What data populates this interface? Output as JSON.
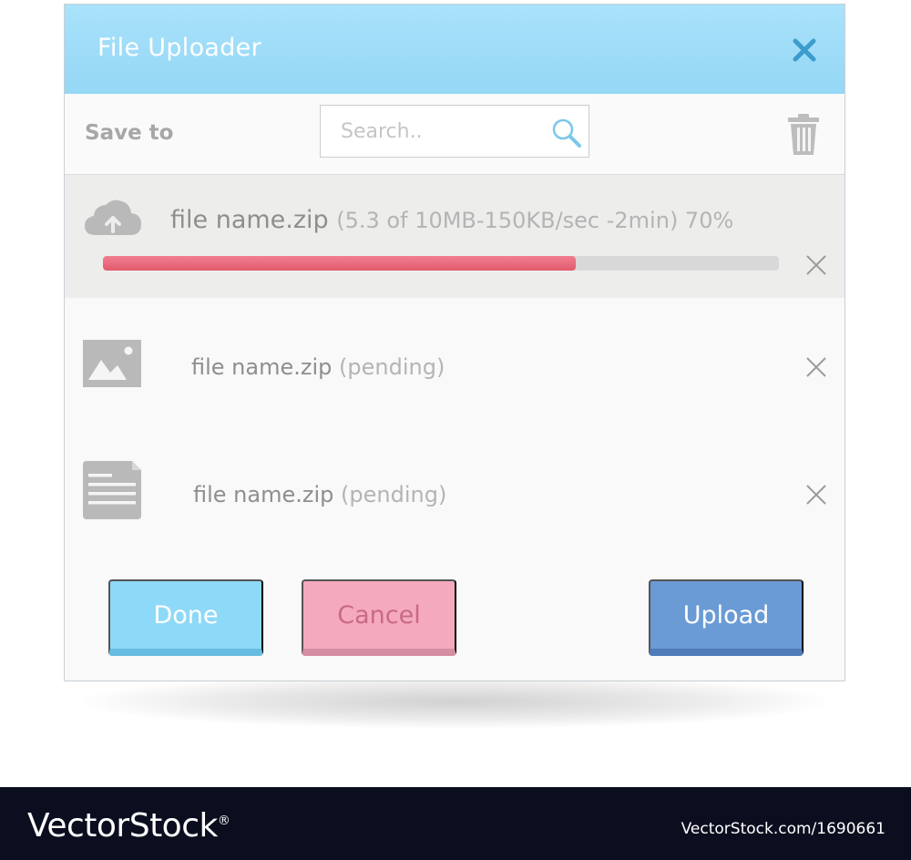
{
  "dialog": {
    "title": "File Uploader",
    "close_icon": "close-icon",
    "accent_color": "#95d7f5"
  },
  "toolbar": {
    "save_to_label": "Save to",
    "search_placeholder": "Search..",
    "search_icon": "search-icon",
    "trash_icon": "trash-icon"
  },
  "files": [
    {
      "icon": "cloud-upload-icon",
      "name": "file name.zip",
      "status": "(5.3 of 10MB-150KB/sec -2min) 70%",
      "progress_percent": 70,
      "progress_color": "#e25a6d",
      "remove_icon": "remove-icon"
    },
    {
      "icon": "image-file-icon",
      "name": "file name.zip",
      "status": "(pending)",
      "remove_icon": "remove-icon"
    },
    {
      "icon": "document-file-icon",
      "name": "file name.zip",
      "status": "(pending)",
      "remove_icon": "remove-icon"
    }
  ],
  "buttons": {
    "done": "Done",
    "cancel": "Cancel",
    "upload": "Upload"
  },
  "footer": {
    "logo_vector": "Vector",
    "logo_stock": "Stock",
    "logo_reg": "®",
    "image_id": "VectorStock.com/1690661"
  }
}
